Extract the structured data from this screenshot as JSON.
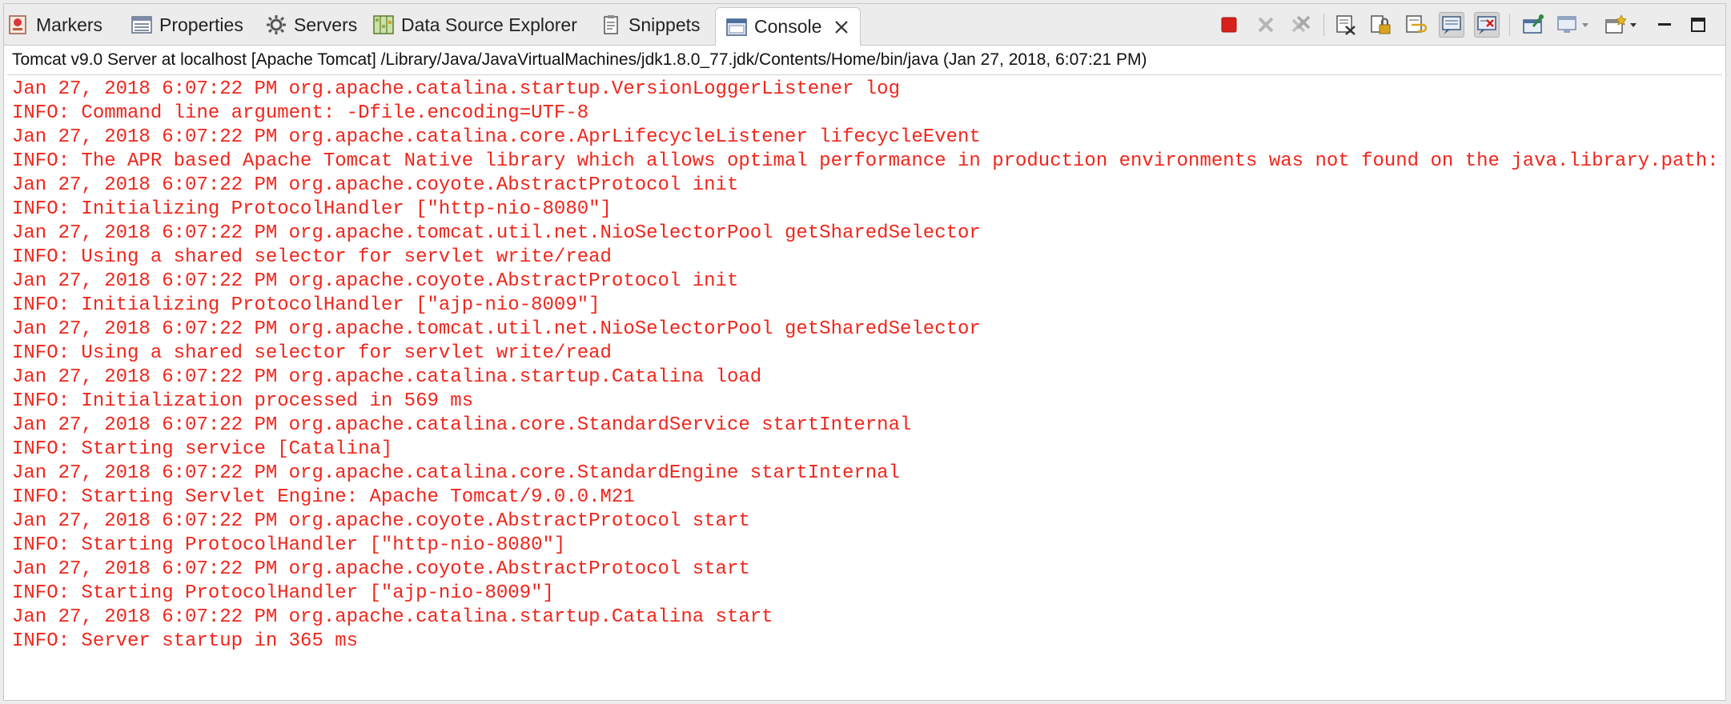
{
  "tabs": [
    {
      "label": "Markers",
      "icon": "markers-icon"
    },
    {
      "label": "Properties",
      "icon": "properties-icon"
    },
    {
      "label": "Servers",
      "icon": "servers-icon"
    },
    {
      "label": "Data Source Explorer",
      "icon": "data-source-explorer-icon"
    },
    {
      "label": "Snippets",
      "icon": "snippets-icon"
    },
    {
      "label": "Console",
      "icon": "console-icon",
      "active": true
    }
  ],
  "toolbar": {
    "icons": [
      "terminate-icon",
      "remove-launch-icon",
      "remove-all-terminated-icon",
      "clear-console-icon",
      "scroll-lock-icon",
      "word-wrap-icon",
      "show-on-stdout-icon",
      "show-on-stderr-icon",
      "pin-console-icon",
      "display-console-icon",
      "open-console-icon",
      "minimize-icon",
      "maximize-icon"
    ]
  },
  "console": {
    "title": "Tomcat v9.0 Server at localhost [Apache Tomcat] /Library/Java/JavaVirtualMachines/jdk1.8.0_77.jdk/Contents/Home/bin/java (Jan 27, 2018, 6:07:21 PM)",
    "text_color": "#f0261c",
    "lines": [
      "Jan 27, 2018 6:07:22 PM org.apache.catalina.startup.VersionLoggerListener log",
      "INFO: Command line argument: -Dfile.encoding=UTF-8",
      "Jan 27, 2018 6:07:22 PM org.apache.catalina.core.AprLifecycleListener lifecycleEvent",
      "INFO: The APR based Apache Tomcat Native library which allows optimal performance in production environments was not found on the java.library.path: [/Us",
      "Jan 27, 2018 6:07:22 PM org.apache.coyote.AbstractProtocol init",
      "INFO: Initializing ProtocolHandler [\"http-nio-8080\"]",
      "Jan 27, 2018 6:07:22 PM org.apache.tomcat.util.net.NioSelectorPool getSharedSelector",
      "INFO: Using a shared selector for servlet write/read",
      "Jan 27, 2018 6:07:22 PM org.apache.coyote.AbstractProtocol init",
      "INFO: Initializing ProtocolHandler [\"ajp-nio-8009\"]",
      "Jan 27, 2018 6:07:22 PM org.apache.tomcat.util.net.NioSelectorPool getSharedSelector",
      "INFO: Using a shared selector for servlet write/read",
      "Jan 27, 2018 6:07:22 PM org.apache.catalina.startup.Catalina load",
      "INFO: Initialization processed in 569 ms",
      "Jan 27, 2018 6:07:22 PM org.apache.catalina.core.StandardService startInternal",
      "INFO: Starting service [Catalina]",
      "Jan 27, 2018 6:07:22 PM org.apache.catalina.core.StandardEngine startInternal",
      "INFO: Starting Servlet Engine: Apache Tomcat/9.0.0.M21",
      "Jan 27, 2018 6:07:22 PM org.apache.coyote.AbstractProtocol start",
      "INFO: Starting ProtocolHandler [\"http-nio-8080\"]",
      "Jan 27, 2018 6:07:22 PM org.apache.coyote.AbstractProtocol start",
      "INFO: Starting ProtocolHandler [\"ajp-nio-8009\"]",
      "Jan 27, 2018 6:07:22 PM org.apache.catalina.startup.Catalina start",
      "INFO: Server startup in 365 ms"
    ]
  }
}
